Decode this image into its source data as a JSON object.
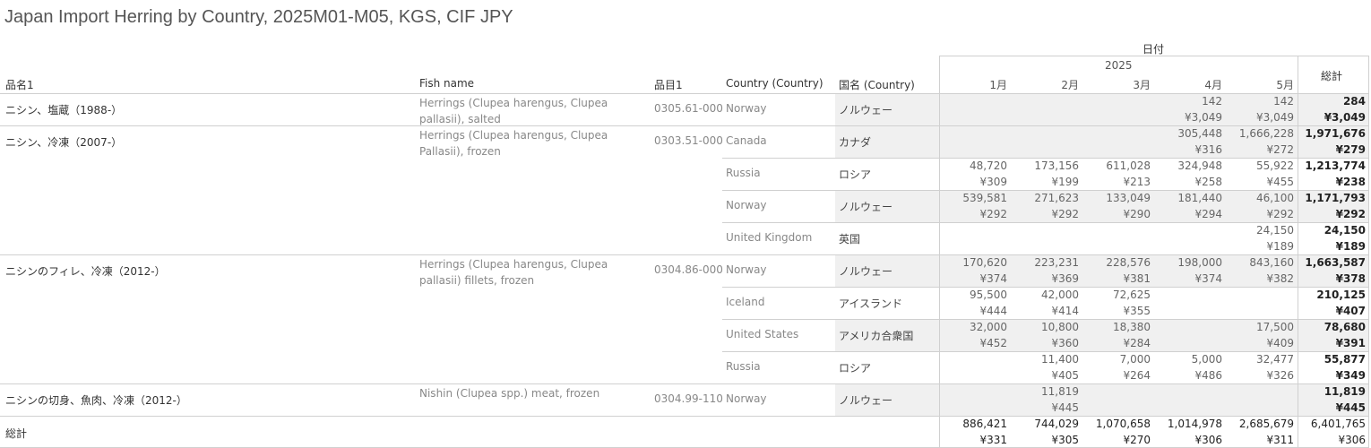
{
  "title": "Japan Import Herring by Country, 2025M01-M05, KGS, CIF JPY",
  "headers": {
    "date_group": "日付",
    "year": "2025",
    "months": [
      "1月",
      "2月",
      "3月",
      "4月",
      "5月"
    ],
    "total": "総計",
    "col_name1": "品名1",
    "col_fish": "Fish name",
    "col_code": "品目1",
    "col_country": "Country (Country)",
    "col_jp": "国名 (Country)"
  },
  "groups": [
    {
      "name": "ニシン、塩蔵（1988-）",
      "fish": "Herrings (Clupea harengus, Clupea pallasii), salted",
      "code": "0305.61-000",
      "rows": [
        {
          "country": "Norway",
          "jp": "ノルウェー",
          "qty": [
            "",
            "",
            "",
            "142",
            "142"
          ],
          "price": [
            "",
            "",
            "",
            "¥3,049",
            "¥3,049"
          ],
          "total_qty": "284",
          "total_price": "¥3,049"
        }
      ]
    },
    {
      "name": "ニシン、冷凍（2007-）",
      "fish": "Herrings (Clupea harengus, Clupea Pallasii), frozen",
      "code": "0303.51-000",
      "rows": [
        {
          "country": "Canada",
          "jp": "カナダ",
          "qty": [
            "",
            "",
            "",
            "305,448",
            "1,666,228"
          ],
          "price": [
            "",
            "",
            "",
            "¥316",
            "¥272"
          ],
          "total_qty": "1,971,676",
          "total_price": "¥279"
        },
        {
          "country": "Russia",
          "jp": "ロシア",
          "qty": [
            "48,720",
            "173,156",
            "611,028",
            "324,948",
            "55,922"
          ],
          "price": [
            "¥309",
            "¥199",
            "¥213",
            "¥258",
            "¥455"
          ],
          "total_qty": "1,213,774",
          "total_price": "¥238"
        },
        {
          "country": "Norway",
          "jp": "ノルウェー",
          "qty": [
            "539,581",
            "271,623",
            "133,049",
            "181,440",
            "46,100"
          ],
          "price": [
            "¥292",
            "¥292",
            "¥290",
            "¥294",
            "¥292"
          ],
          "total_qty": "1,171,793",
          "total_price": "¥292"
        },
        {
          "country": "United Kingdom",
          "jp": "英国",
          "qty": [
            "",
            "",
            "",
            "",
            "24,150"
          ],
          "price": [
            "",
            "",
            "",
            "",
            "¥189"
          ],
          "total_qty": "24,150",
          "total_price": "¥189"
        }
      ]
    },
    {
      "name": "ニシンのフィレ、冷凍（2012-）",
      "fish": "Herrings (Clupea harengus, Clupea pallasii) fillets, frozen",
      "code": "0304.86-000",
      "rows": [
        {
          "country": "Norway",
          "jp": "ノルウェー",
          "qty": [
            "170,620",
            "223,231",
            "228,576",
            "198,000",
            "843,160"
          ],
          "price": [
            "¥374",
            "¥369",
            "¥381",
            "¥374",
            "¥382"
          ],
          "total_qty": "1,663,587",
          "total_price": "¥378"
        },
        {
          "country": "Iceland",
          "jp": "アイスランド",
          "qty": [
            "95,500",
            "42,000",
            "72,625",
            "",
            ""
          ],
          "price": [
            "¥444",
            "¥414",
            "¥355",
            "",
            ""
          ],
          "total_qty": "210,125",
          "total_price": "¥407"
        },
        {
          "country": "United States",
          "jp": "アメリカ合衆国",
          "qty": [
            "32,000",
            "10,800",
            "18,380",
            "",
            "17,500"
          ],
          "price": [
            "¥452",
            "¥360",
            "¥284",
            "",
            "¥409"
          ],
          "total_qty": "78,680",
          "total_price": "¥391"
        },
        {
          "country": "Russia",
          "jp": "ロシア",
          "qty": [
            "",
            "11,400",
            "7,000",
            "5,000",
            "32,477"
          ],
          "price": [
            "",
            "¥405",
            "¥264",
            "¥486",
            "¥326"
          ],
          "total_qty": "55,877",
          "total_price": "¥349"
        }
      ]
    },
    {
      "name": "ニシンの切身、魚肉、冷凍（2012-）",
      "fish": "Nishin (Clupea spp.) meat, frozen",
      "code": "0304.99-110",
      "rows": [
        {
          "country": "Norway",
          "jp": "ノルウェー",
          "qty": [
            "",
            "11,819",
            "",
            "",
            ""
          ],
          "price": [
            "",
            "¥445",
            "",
            "",
            ""
          ],
          "total_qty": "11,819",
          "total_price": "¥445"
        }
      ]
    }
  ],
  "grand_total": {
    "label": "総計",
    "qty": [
      "886,421",
      "744,029",
      "1,070,658",
      "1,014,978",
      "2,685,679"
    ],
    "price": [
      "¥331",
      "¥305",
      "¥270",
      "¥306",
      "¥311"
    ],
    "total_qty": "6,401,765",
    "total_price": "¥306"
  }
}
